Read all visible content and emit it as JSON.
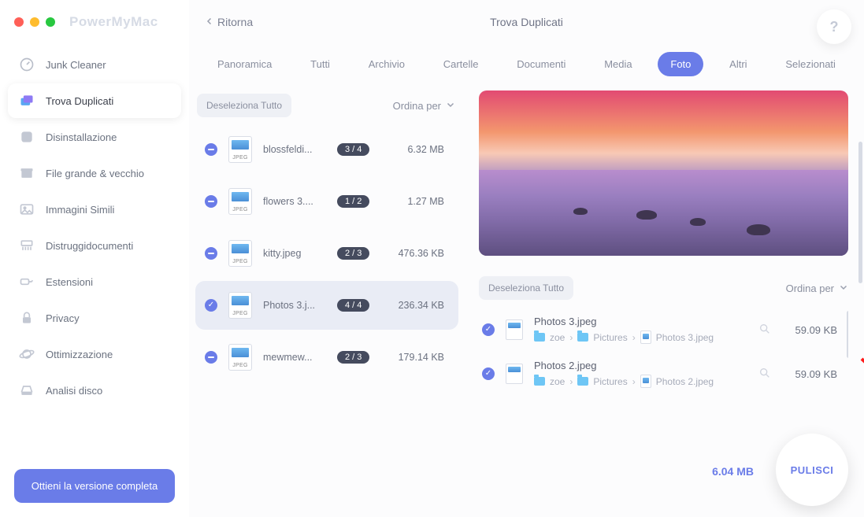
{
  "brand": "PowerMyMac",
  "header": {
    "back": "Ritorna",
    "title": "Trova Duplicati",
    "help": "?"
  },
  "sidebar": {
    "items": [
      {
        "label": "Junk Cleaner"
      },
      {
        "label": "Trova Duplicati"
      },
      {
        "label": "Disinstallazione"
      },
      {
        "label": "File grande & vecchio"
      },
      {
        "label": "Immagini Simili"
      },
      {
        "label": "Distruggidocumenti"
      },
      {
        "label": "Estensioni"
      },
      {
        "label": "Privacy"
      },
      {
        "label": "Ottimizzazione"
      },
      {
        "label": "Analisi disco"
      }
    ],
    "upgrade": "Ottieni la versione completa"
  },
  "tabs": {
    "items": [
      {
        "label": "Panoramica"
      },
      {
        "label": "Tutti"
      },
      {
        "label": "Archivio"
      },
      {
        "label": "Cartelle"
      },
      {
        "label": "Documenti"
      },
      {
        "label": "Media"
      },
      {
        "label": "Foto"
      },
      {
        "label": "Altri"
      },
      {
        "label": "Selezionati"
      }
    ],
    "activeIndex": 6
  },
  "list": {
    "deselect": "Deseleziona Tutto",
    "sortby": "Ordina per",
    "file_format": "JPEG",
    "files": [
      {
        "name": "blossfeldi...",
        "ratio": "3 / 4",
        "size": "6.32 MB",
        "check": "minus",
        "selected": false
      },
      {
        "name": "flowers 3....",
        "ratio": "1 / 2",
        "size": "1.27 MB",
        "check": "minus",
        "selected": false
      },
      {
        "name": "kitty.jpeg",
        "ratio": "2 / 3",
        "size": "476.36 KB",
        "check": "minus",
        "selected": false
      },
      {
        "name": "Photos 3.j...",
        "ratio": "4 / 4",
        "size": "236.34 KB",
        "check": "checked",
        "selected": true
      },
      {
        "name": "mewmew...",
        "ratio": "2 / 3",
        "size": "179.14 KB",
        "check": "minus",
        "selected": false
      }
    ]
  },
  "detail": {
    "deselect": "Deseleziona Tutto",
    "sortby": "Ordina per",
    "items": [
      {
        "name": "Photos 3.jpeg",
        "path": [
          "zoe",
          "Pictures",
          "Photos 3.jpeg"
        ],
        "size": "59.09 KB"
      },
      {
        "name": "Photos 2.jpeg",
        "path": [
          "zoe",
          "Pictures",
          "Photos 2.jpeg"
        ],
        "size": "59.09 KB"
      }
    ]
  },
  "footer": {
    "total": "6.04 MB",
    "clean": "PULISCI"
  }
}
